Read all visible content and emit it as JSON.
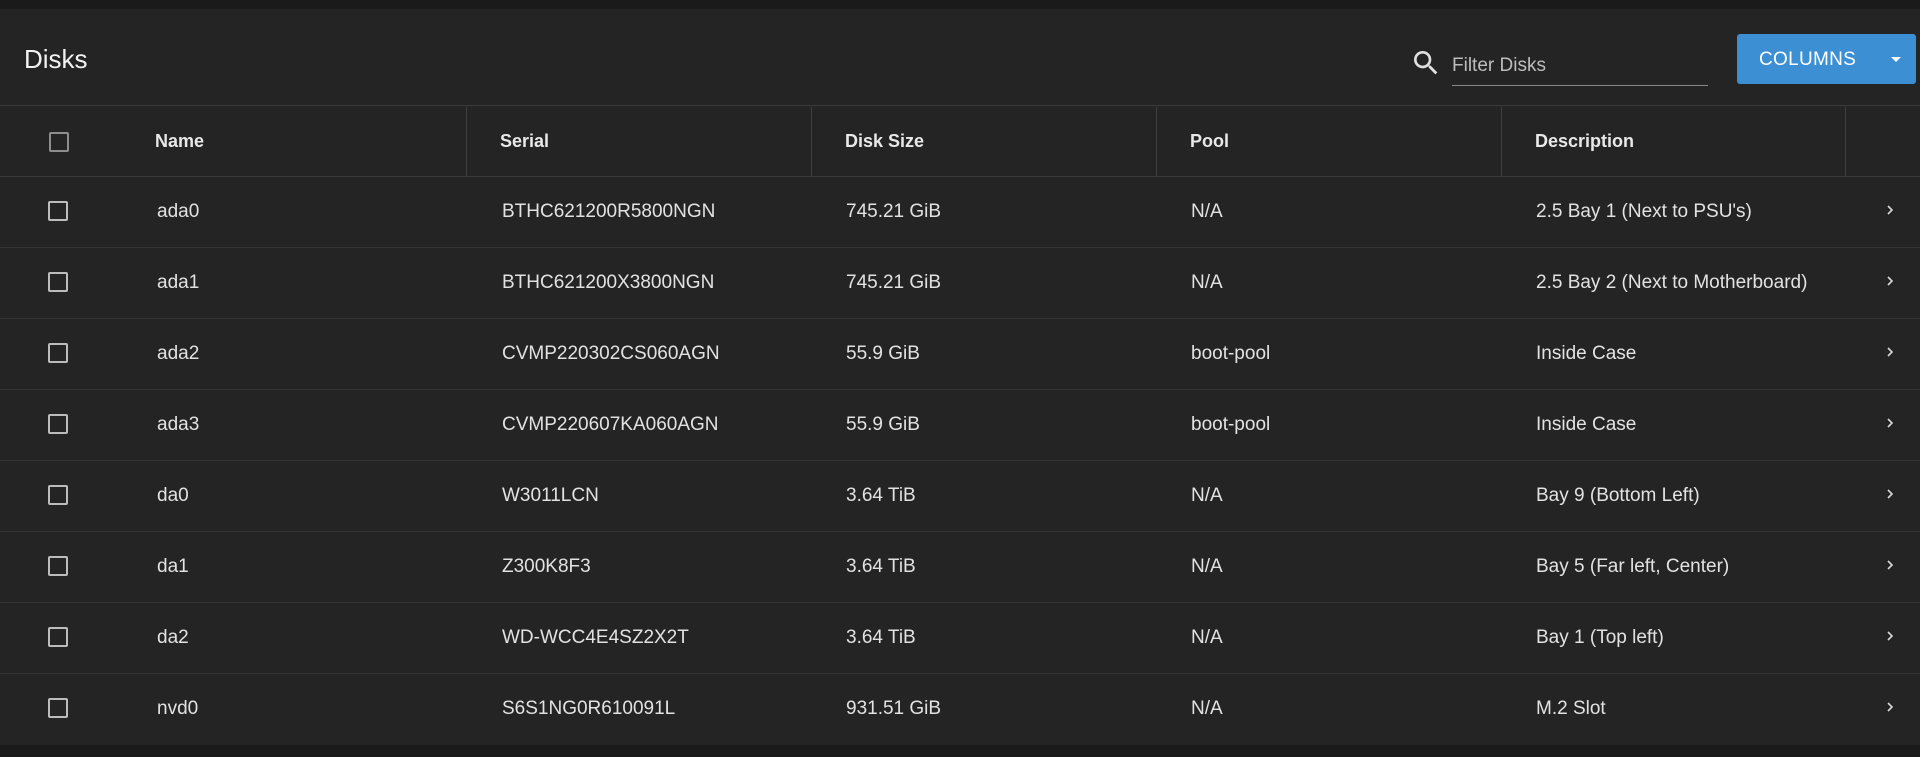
{
  "page": {
    "title": "Disks"
  },
  "search": {
    "placeholder": "Filter Disks",
    "value": "",
    "icon": "search-icon"
  },
  "columns_button": {
    "label": "COLUMNS",
    "icon": "caret-down-icon",
    "color": "#3d8fd3"
  },
  "table": {
    "headers": {
      "name": "Name",
      "serial": "Serial",
      "disk_size": "Disk Size",
      "pool": "Pool",
      "description": "Description"
    },
    "rows": [
      {
        "name": "ada0",
        "serial": "BTHC621200R5800NGN",
        "disk_size": "745.21 GiB",
        "pool": "N/A",
        "description": "2.5 Bay 1 (Next to PSU's)"
      },
      {
        "name": "ada1",
        "serial": "BTHC621200X3800NGN",
        "disk_size": "745.21 GiB",
        "pool": "N/A",
        "description": "2.5 Bay 2 (Next to Motherboard)"
      },
      {
        "name": "ada2",
        "serial": "CVMP220302CS060AGN",
        "disk_size": "55.9 GiB",
        "pool": "boot-pool",
        "description": "Inside Case"
      },
      {
        "name": "ada3",
        "serial": "CVMP220607KA060AGN",
        "disk_size": "55.9 GiB",
        "pool": "boot-pool",
        "description": "Inside Case"
      },
      {
        "name": "da0",
        "serial": "W3011LCN",
        "disk_size": "3.64 TiB",
        "pool": "N/A",
        "description": "Bay 9 (Bottom Left)"
      },
      {
        "name": "da1",
        "serial": "Z300K8F3",
        "disk_size": "3.64 TiB",
        "pool": "N/A",
        "description": "Bay 5 (Far left, Center)"
      },
      {
        "name": "da2",
        "serial": "WD-WCC4E4SZ2X2T",
        "disk_size": "3.64 TiB",
        "pool": "N/A",
        "description": "Bay 1 (Top left)"
      },
      {
        "name": "nvd0",
        "serial": "S6S1NG0R610091L",
        "disk_size": "931.51 GiB",
        "pool": "N/A",
        "description": "M.2 Slot"
      }
    ]
  }
}
